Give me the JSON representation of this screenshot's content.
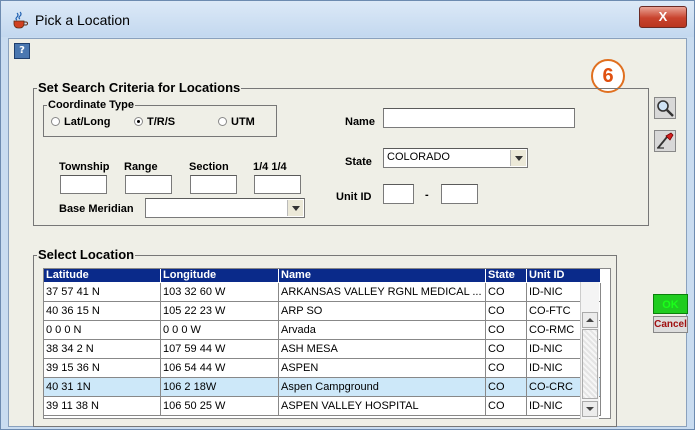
{
  "window": {
    "title": "Pick a Location",
    "close_label": "X"
  },
  "help_icon": "?",
  "badge": "6",
  "search_criteria": {
    "title": "Set Search Criteria for Locations",
    "coordinate_type": {
      "title": "Coordinate Type",
      "options": [
        "Lat/Long",
        "T/R/S",
        "UTM"
      ],
      "selected": "T/R/S"
    },
    "labels": {
      "township": "Township",
      "range": "Range",
      "section": "Section",
      "quarter": "1/4 1/4",
      "base_meridian": "Base Meridian",
      "name": "Name",
      "state": "State",
      "unit_id": "Unit ID",
      "unit_sep": "-"
    },
    "values": {
      "township": "",
      "range": "",
      "section": "",
      "quarter": "",
      "base_meridian": "",
      "name": "",
      "state": "COLORADO",
      "unit_id_a": "",
      "unit_id_b": ""
    },
    "tools": [
      "magnifier-icon",
      "clear-search-icon"
    ]
  },
  "select_location": {
    "title": "Select Location",
    "columns": [
      "Latitude",
      "Longitude",
      "Name",
      "State",
      "Unit ID"
    ],
    "rows": [
      [
        "37 57 41 N",
        "103 32 60 W",
        "ARKANSAS VALLEY RGNL MEDICAL ...",
        "CO",
        "ID-NIC"
      ],
      [
        "40 36 15 N",
        "105 22 23 W",
        "ARP SO",
        "CO",
        "CO-FTC"
      ],
      [
        "0 0 0 N",
        "0 0 0 W",
        "Arvada",
        "CO",
        "CO-RMC"
      ],
      [
        "38 34 2 N",
        "107 59 44 W",
        "ASH MESA",
        "CO",
        "ID-NIC"
      ],
      [
        "39 15 36 N",
        "106 54 44 W",
        "ASPEN",
        "CO",
        "ID-NIC"
      ],
      [
        " 40 31  1N",
        " 106  2 18W",
        "Aspen Campground",
        "CO",
        "CO-CRC"
      ],
      [
        "39 11 38 N",
        "106 50 25 W",
        "ASPEN VALLEY HOSPITAL",
        "CO",
        "ID-NIC"
      ]
    ],
    "selected_row": 5
  },
  "buttons": {
    "ok": "OK",
    "cancel": "Cancel"
  }
}
